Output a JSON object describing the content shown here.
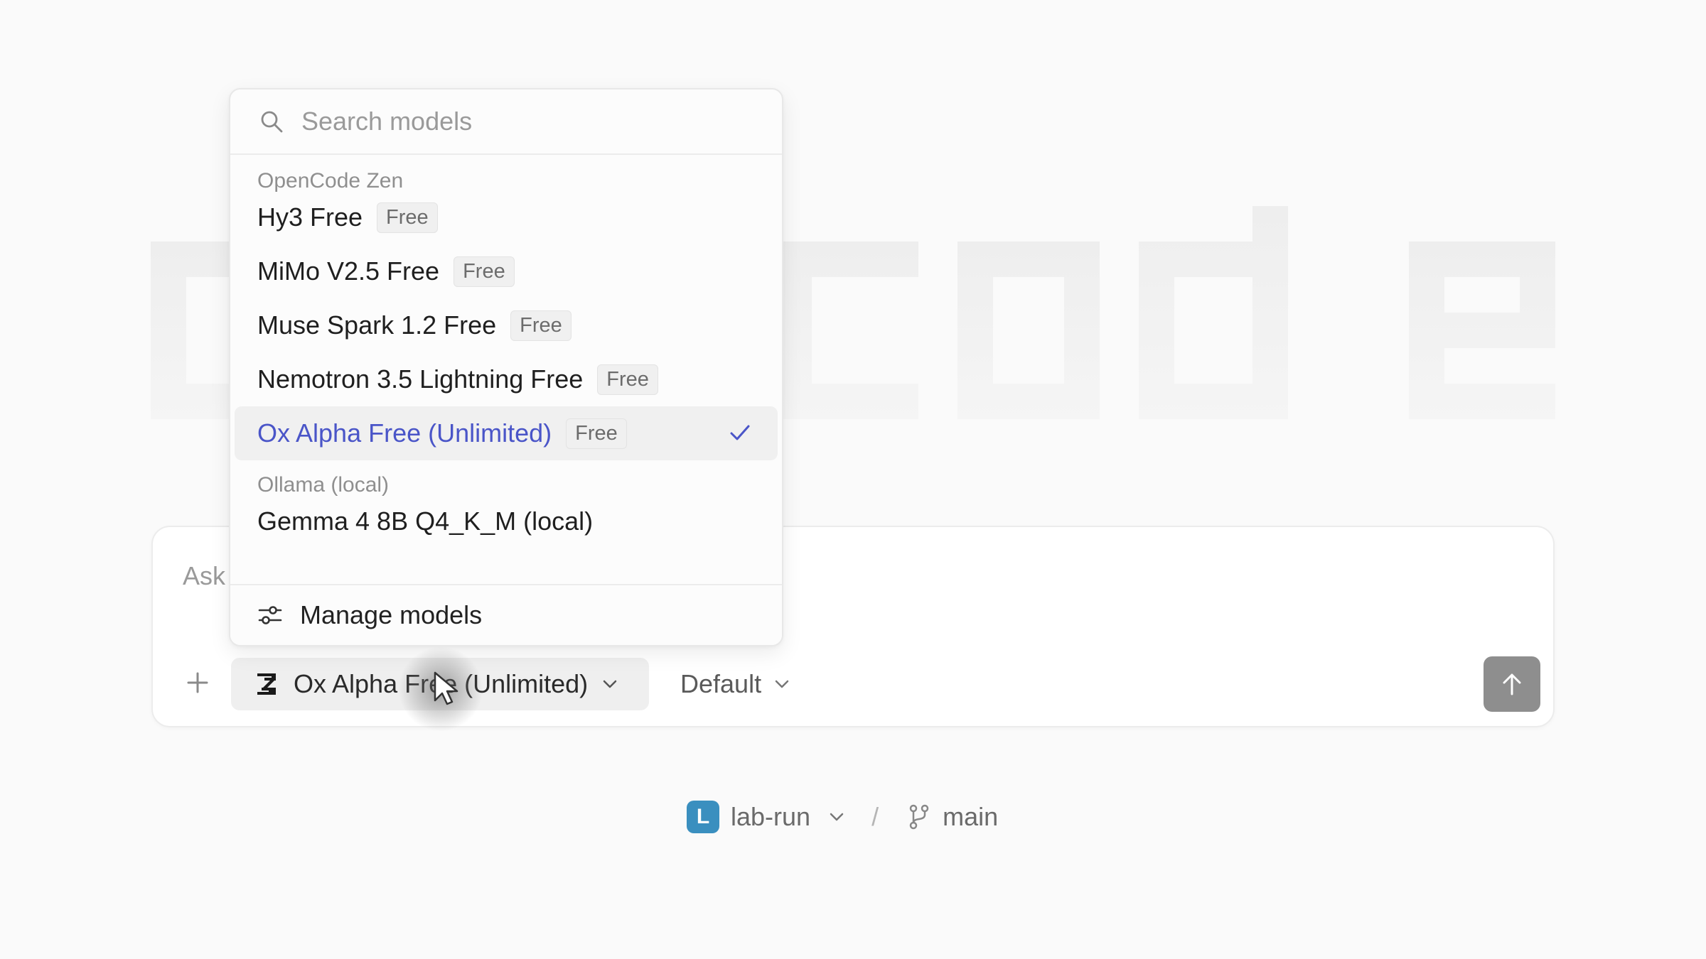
{
  "composer": {
    "placeholder": "Ask",
    "model_label": "Ox Alpha Free (Unlimited)",
    "agent_label": "Default"
  },
  "workspace": {
    "project_initial": "L",
    "project_name": "lab-run",
    "separator": "/",
    "branch": "main"
  },
  "dropdown": {
    "search_placeholder": "Search models",
    "groups": [
      {
        "label": "OpenCode Zen",
        "items": [
          {
            "name": "Hy3 Free",
            "badge": "Free"
          },
          {
            "name": "MiMo V2.5 Free",
            "badge": "Free"
          },
          {
            "name": "Muse Spark 1.2 Free",
            "badge": "Free"
          },
          {
            "name": "Nemotron 3.5 Lightning Free",
            "badge": "Free"
          },
          {
            "name": "Ox Alpha Free (Unlimited)",
            "badge": "Free",
            "selected": true
          }
        ]
      },
      {
        "label": "Ollama (local)",
        "items": [
          {
            "name": "Gemma 4 8B Q4_K_M (local)"
          }
        ]
      }
    ],
    "manage_label": "Manage models"
  },
  "colors": {
    "selected_text": "#4a55c8",
    "project_avatar": "#3a8fbf",
    "send_button": "#8e8e8e"
  },
  "icons": [
    "search-icon",
    "check-icon",
    "sliders-icon",
    "plus-icon",
    "zen-logo-icon",
    "chevron-down-icon",
    "arrow-up-icon",
    "branch-icon",
    "cursor-icon"
  ]
}
